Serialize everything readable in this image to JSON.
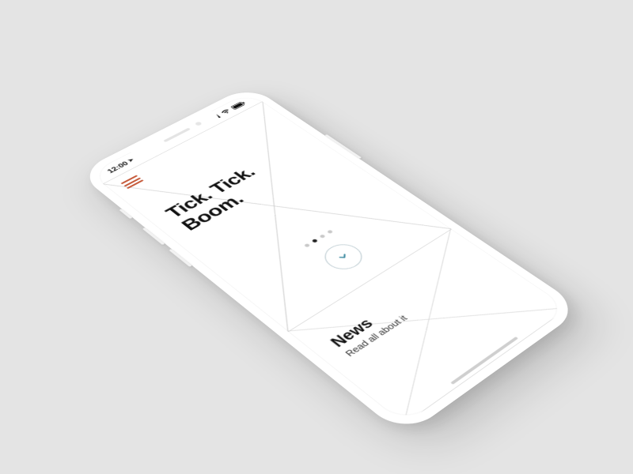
{
  "statusbar": {
    "time": "12:00",
    "location_arrow": "➤"
  },
  "menu": {
    "color": "#c65a3a"
  },
  "hero": {
    "headline_line1": "Tick. Tick.",
    "headline_line2": "Boom.",
    "dots_total": 4,
    "dots_active_index": 1
  },
  "news": {
    "title": "News",
    "subtitle": "Read all about it"
  },
  "colors": {
    "accent_orange": "#c65a3a",
    "accent_teal": "#3d8aa0",
    "hairline": "#dcdcdc"
  }
}
